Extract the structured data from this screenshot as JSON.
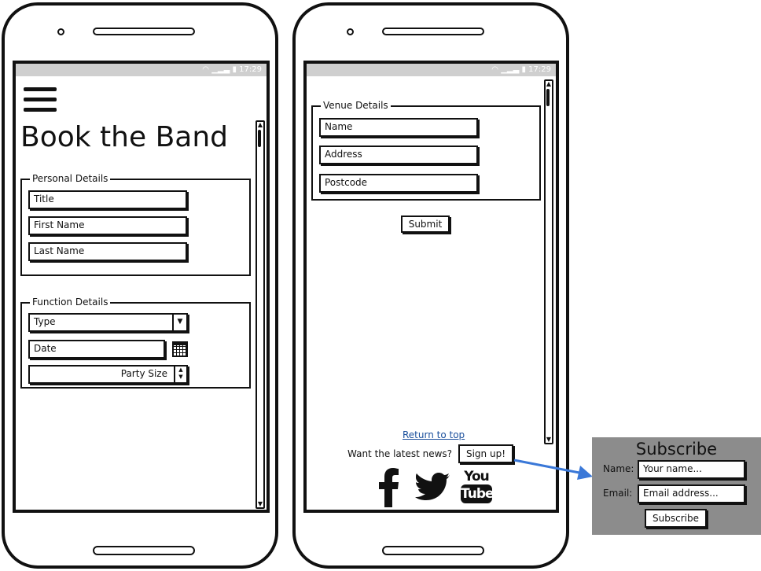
{
  "left_phone": {
    "status_time": "17:29",
    "title": "Book the Band",
    "personal_details": {
      "legend": "Personal Details",
      "title_placeholder": "Title",
      "first_name_placeholder": "First Name",
      "last_name_placeholder": "Last Name"
    },
    "function_details": {
      "legend": "Function Details",
      "type_value": "Type",
      "date_placeholder": "Date",
      "party_size_value": "Party Size"
    }
  },
  "right_phone": {
    "status_time": "17:29",
    "venue_details": {
      "legend": "Venue Details",
      "name_placeholder": "Name",
      "address_placeholder": "Address",
      "postcode_placeholder": "Postcode"
    },
    "submit_label": "Submit",
    "return_to_top": "Return to top",
    "latest_news_text": "Want the latest news?",
    "sign_up_label": "Sign up!",
    "youtube_you": "You",
    "youtube_tube": "Tube"
  },
  "subscribe_popup": {
    "title": "Subscribe",
    "name_label": "Name:",
    "name_placeholder": "Your name...",
    "email_label": "Email:",
    "email_placeholder": "Email address...",
    "button_label": "Subscribe"
  },
  "colors": {
    "link": "#1a4f9c",
    "arrow": "#3a78d8",
    "status_bar": "#cfcfcf",
    "panel": "#8c8c8c"
  },
  "icons": {
    "menu": "hamburger-icon",
    "calendar": "calendar-icon",
    "facebook": "facebook-icon",
    "twitter": "twitter-icon",
    "youtube": "youtube-icon",
    "wifi": "wifi-icon",
    "signal": "signal-icon",
    "battery": "battery-icon"
  }
}
